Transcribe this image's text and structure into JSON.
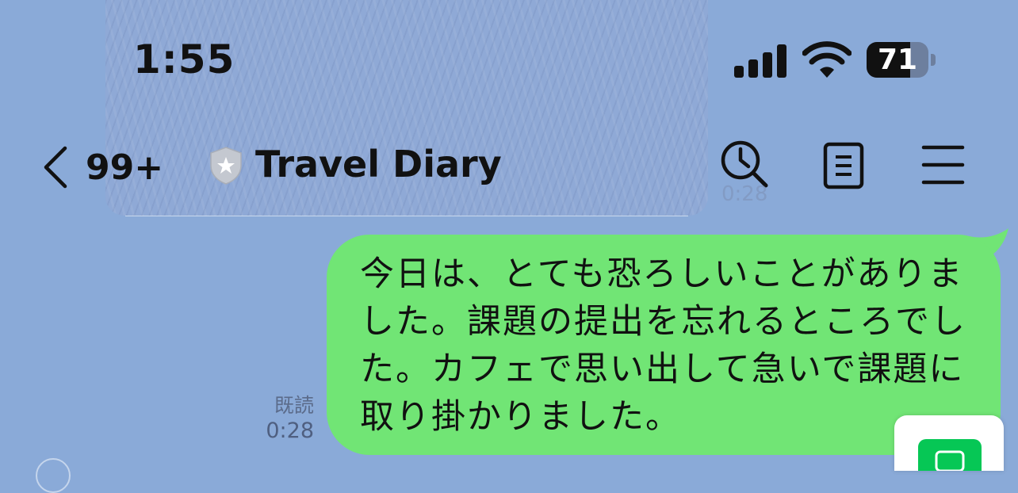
{
  "status_bar": {
    "time": "1:55",
    "battery_level": 71,
    "battery_text": "71",
    "signal_bars": 4
  },
  "header": {
    "back_count": "99+",
    "title": "Travel Diary"
  },
  "messages": [
    {
      "text": "今日は、とても恐ろしいことがありました。課題の提出を忘れるところでした。カフェで思い出して急いで課題に取り掛かりました。",
      "read_label": "既読",
      "time": "0:28"
    }
  ],
  "behind_header_time": "0:28",
  "colors": {
    "chat_background": "#8aaad8",
    "bubble_green": "#71e575",
    "app_green": "#06c755"
  }
}
